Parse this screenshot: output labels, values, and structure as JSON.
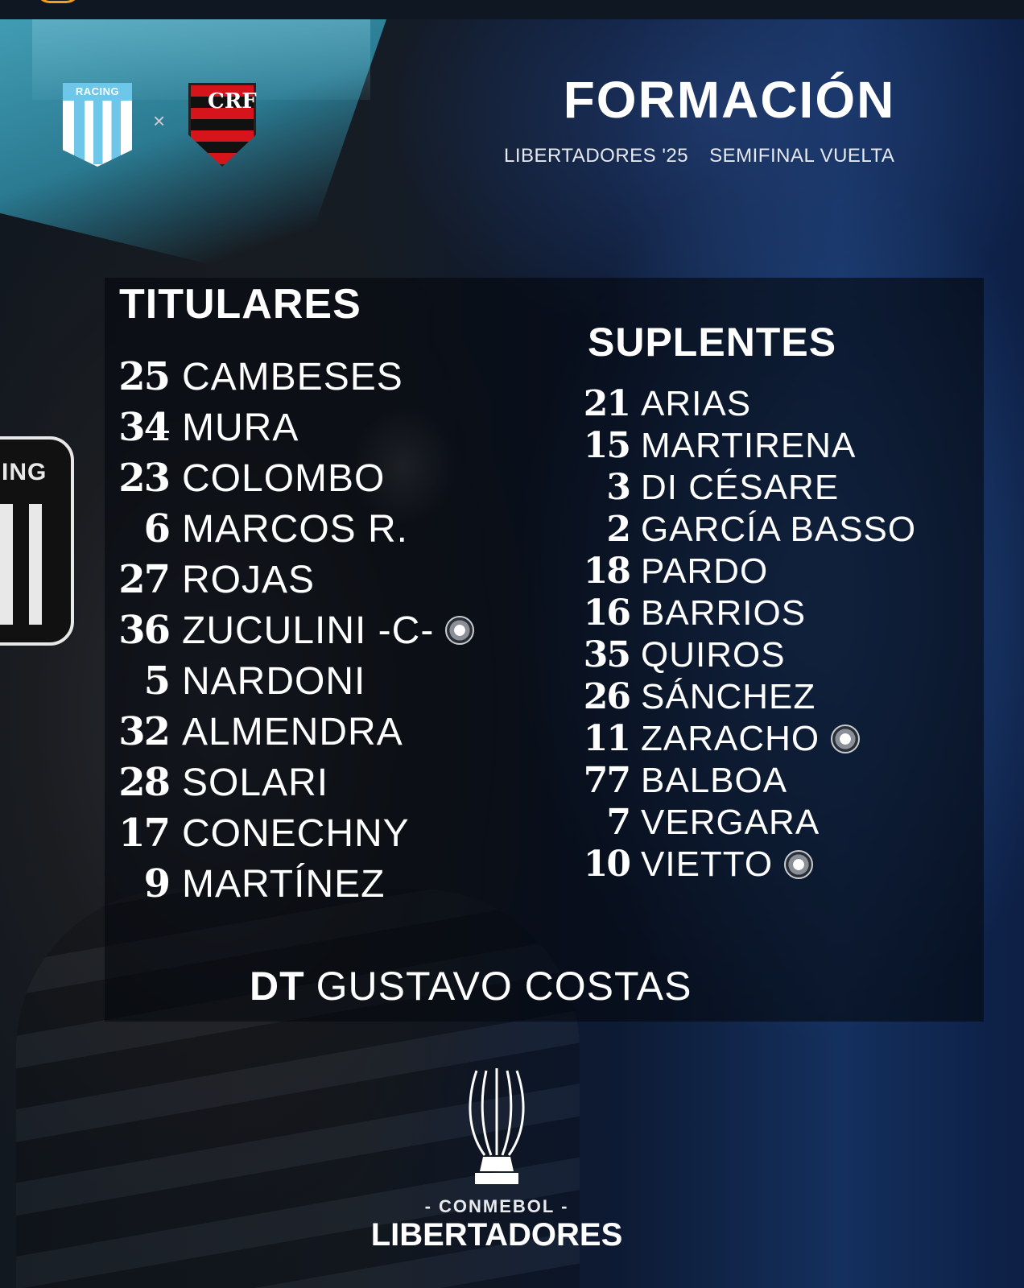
{
  "header": {
    "title": "FORMACIÓN",
    "competition": "LIBERTADORES '25",
    "stage": "SEMIFINAL VUELTA"
  },
  "teams": {
    "home_badge_text": "RACING",
    "vs_symbol": "×",
    "away_badge_text": "CRF"
  },
  "titulares": {
    "heading": "TITULARES",
    "players": [
      {
        "number": "25",
        "name": "CAMBESES"
      },
      {
        "number": "34",
        "name": "MURA"
      },
      {
        "number": "23",
        "name": "COLOMBO"
      },
      {
        "number": "6",
        "name": "MARCOS R."
      },
      {
        "number": "27",
        "name": "ROJAS"
      },
      {
        "number": "36",
        "name": "ZUCULINI -C-"
      },
      {
        "number": "5",
        "name": "NARDONI"
      },
      {
        "number": "32",
        "name": "ALMENDRA"
      },
      {
        "number": "28",
        "name": "SOLARI"
      },
      {
        "number": "17",
        "name": "CONECHNY"
      },
      {
        "number": "9",
        "name": "MARTÍNEZ"
      }
    ]
  },
  "suplentes": {
    "heading": "SUPLENTES",
    "players": [
      {
        "number": "21",
        "name": "ARIAS"
      },
      {
        "number": "15",
        "name": "MARTIRENA"
      },
      {
        "number": "3",
        "name": "DI CÉSARE"
      },
      {
        "number": "2",
        "name": "GARCÍA BASSO"
      },
      {
        "number": "18",
        "name": "PARDO"
      },
      {
        "number": "16",
        "name": "BARRIOS"
      },
      {
        "number": "35",
        "name": "QUIROS"
      },
      {
        "number": "26",
        "name": "SÁNCHEZ"
      },
      {
        "number": "11",
        "name": "ZARACHO"
      },
      {
        "number": "77",
        "name": "BALBOA"
      },
      {
        "number": "7",
        "name": "VERGARA"
      },
      {
        "number": "10",
        "name": "VIETTO"
      }
    ]
  },
  "coach": {
    "prefix": "DT",
    "name": "GUSTAVO COSTAS"
  },
  "footer": {
    "org": "- CONMEBOL -",
    "tournament": "LIBERTADORES"
  }
}
